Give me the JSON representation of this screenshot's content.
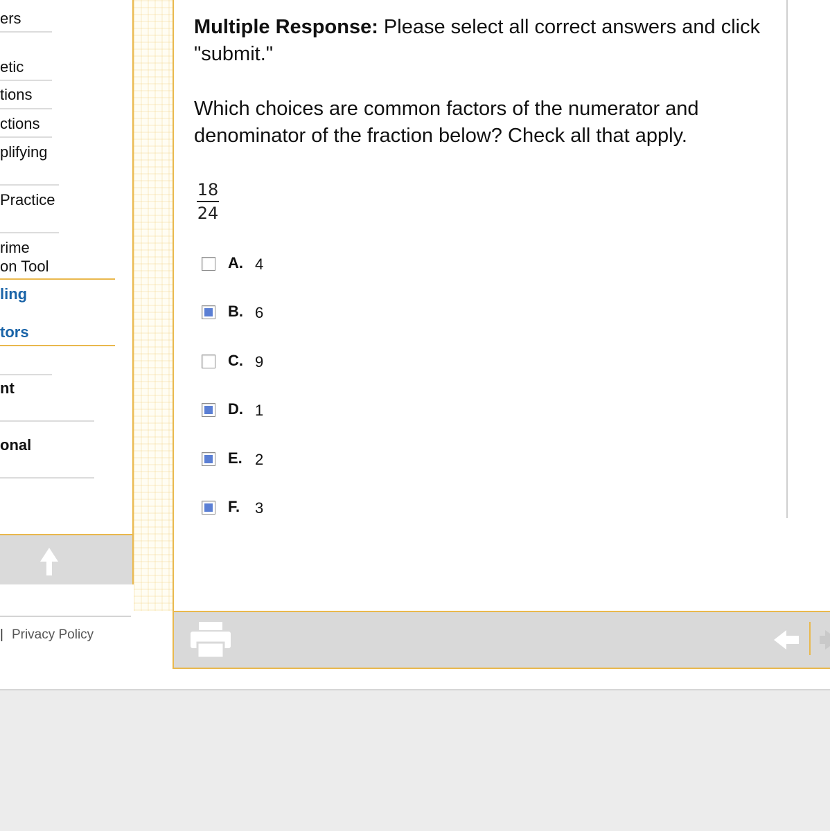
{
  "sidebar": {
    "items": [
      {
        "label": "ers"
      },
      {
        "label": "etic"
      },
      {
        "label": "tions"
      },
      {
        "label": "ctions"
      },
      {
        "label": "plifying"
      },
      {
        "label": "Practice"
      },
      {
        "label": "rime\non Tool"
      },
      {
        "label": "ling"
      },
      {
        "label": "tors"
      },
      {
        "label": "nt"
      },
      {
        "label": "onal"
      }
    ],
    "footer_links": {
      "separator": "|",
      "privacy": "Privacy Policy"
    }
  },
  "question": {
    "type_label": "Multiple Response:",
    "instructions": "Please select all correct answers and click \"submit.\"",
    "prompt": "Which choices are common factors of the numerator and denominator of the fraction below? Check all that apply.",
    "fraction": {
      "numerator": "18",
      "denominator": "24"
    },
    "choices": [
      {
        "letter": "A.",
        "value": "4",
        "checked": false
      },
      {
        "letter": "B.",
        "value": "6",
        "checked": true
      },
      {
        "letter": "C.",
        "value": "9",
        "checked": false
      },
      {
        "letter": "D.",
        "value": "1",
        "checked": true
      },
      {
        "letter": "E.",
        "value": "2",
        "checked": true
      },
      {
        "letter": "F.",
        "value": "3",
        "checked": true
      }
    ]
  },
  "icons": {
    "scroll_up": "arrow-up-icon",
    "print": "printer-icon",
    "back": "arrow-left-icon",
    "forward": "arrow-right-icon"
  },
  "colors": {
    "accent_gold": "#e9b84d",
    "active_link": "#1a64a8",
    "checkbox_fill": "#5b7fd4",
    "toolbar_gray": "#d9d9d9"
  }
}
